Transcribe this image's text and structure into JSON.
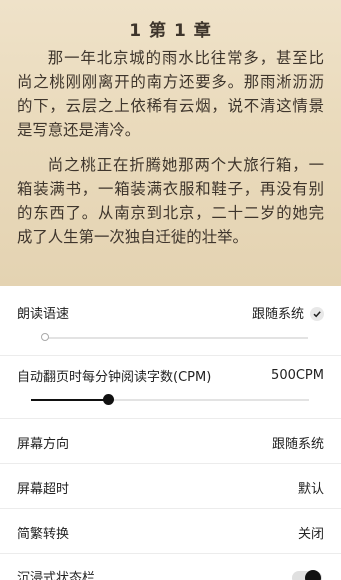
{
  "reader": {
    "chapter_title": "1 第 1 章",
    "paragraphs": [
      "那一年北京城的雨水比往常多，甚至比尚之桃刚刚离开的南方还要多。那雨淅沥沥的下，云层之上依稀有云烟，说不清这情景是写意还是清冷。",
      "尚之桃正在折腾她那两个大旅行箱，一箱装满书，一箱装满衣服和鞋子，再没有别的东西了。从南京到北京，二十二岁的她完成了人生第一次独自迁徙的壮举。"
    ]
  },
  "settings": {
    "speech_speed": {
      "label": "朗读语速",
      "value": "跟随系统",
      "checked": true,
      "level": 0.0
    },
    "auto_page": {
      "label": "自动翻页时每分钟阅读字数(CPM)",
      "value": "500CPM",
      "level": 0.28
    },
    "orientation": {
      "label": "屏幕方向",
      "value": "跟随系统"
    },
    "timeout": {
      "label": "屏幕超时",
      "value": "默认"
    },
    "simp_trad": {
      "label": "简繁转换",
      "value": "关闭"
    },
    "immersive": {
      "label": "沉浸式状态栏",
      "on": true
    }
  }
}
